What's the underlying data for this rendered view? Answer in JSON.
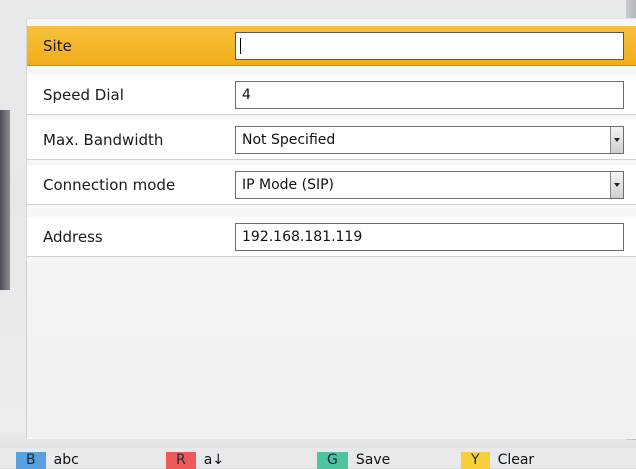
{
  "form": {
    "rows": [
      {
        "label": "Site",
        "value": "",
        "type": "text",
        "selected": true
      },
      {
        "label": "Speed Dial",
        "value": "4",
        "type": "text",
        "selected": false
      },
      {
        "label": "Max. Bandwidth",
        "value": "Not Specified",
        "type": "select",
        "selected": false
      },
      {
        "label": "Connection mode",
        "value": "IP Mode (SIP)",
        "type": "select",
        "selected": false
      },
      {
        "label": "Address",
        "value": "192.168.181.119",
        "type": "text",
        "selected": false
      }
    ]
  },
  "footer": {
    "keys": [
      {
        "tag": "B",
        "label": "abc",
        "color": "#5aa0dc"
      },
      {
        "tag": "R",
        "label": "a↓",
        "color": "#ee5a5a"
      },
      {
        "tag": "G",
        "label": "Save",
        "color": "#4fc3a0"
      },
      {
        "tag": "Y",
        "label": "Clear",
        "color": "#f6cf3a"
      }
    ]
  },
  "colors": {
    "selection": "#f2ac1a"
  }
}
